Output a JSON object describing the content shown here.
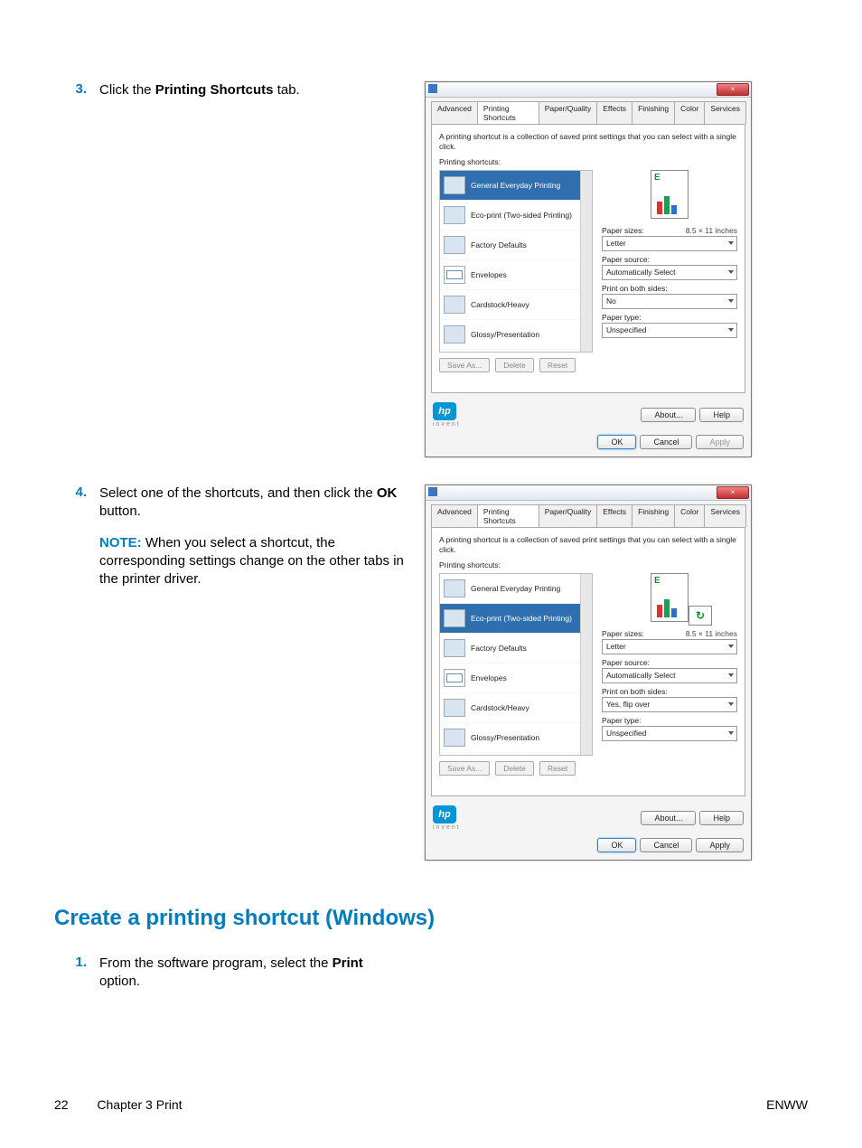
{
  "steps": {
    "s3": {
      "num": "3.",
      "text_pre": "Click the ",
      "text_bold": "Printing Shortcuts",
      "text_post": " tab."
    },
    "s4": {
      "num": "4.",
      "text_pre": "Select one of the shortcuts, and then click the ",
      "text_bold": "OK",
      "text_post": " button.",
      "note_label": "NOTE:",
      "note_text": "When you select a shortcut, the corresponding settings change on the other tabs in the printer driver."
    },
    "s1b": {
      "num": "1.",
      "text_pre": "From the software program, select the ",
      "text_bold": "Print",
      "text_post": " option."
    }
  },
  "section_title": "Create a printing shortcut (Windows)",
  "dialog_common": {
    "close_glyph": "×",
    "tabs": [
      "Advanced",
      "Printing Shortcuts",
      "Paper/Quality",
      "Effects",
      "Finishing",
      "Color",
      "Services"
    ],
    "desc": "A printing shortcut is a collection of saved print settings that you can select with a single click.",
    "list_label": "Printing shortcuts:",
    "items": [
      "General Everyday Printing",
      "Eco-print (Two-sided Printing)",
      "Factory Defaults",
      "Envelopes",
      "Cardstock/Heavy",
      "Glossy/Presentation"
    ],
    "save_as": "Save As...",
    "delete": "Delete",
    "reset": "Reset",
    "about": "About...",
    "help": "Help",
    "ok": "OK",
    "cancel": "Cancel",
    "apply": "Apply",
    "invent": "invent",
    "hp": "hp",
    "paper_sizes_label": "Paper sizes:",
    "paper_sizes_note": "8.5 × 11 inches",
    "paper_sizes_value": "Letter",
    "paper_source_label": "Paper source:",
    "paper_source_value": "Automatically Select",
    "print_both_label": "Print on both sides:",
    "paper_type_label": "Paper type:",
    "paper_type_value": "Unspecified"
  },
  "dialog1": {
    "selected_index": 0,
    "both_sides_value": "No",
    "show_extra_preview": false
  },
  "dialog2": {
    "selected_index": 1,
    "both_sides_value": "Yes, flip over",
    "show_extra_preview": true
  },
  "footer": {
    "page": "22",
    "chapter": "Chapter 3   Print",
    "right": "ENWW"
  }
}
